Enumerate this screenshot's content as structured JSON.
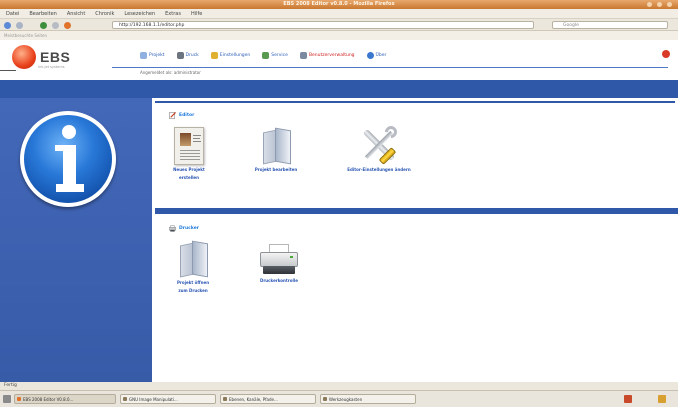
{
  "window": {
    "title": "EBS 2008 Editor v0.8.0 - Mozilla Firefox"
  },
  "menubar": {
    "items": [
      "Datei",
      "Bearbeiten",
      "Ansicht",
      "Chronik",
      "Lesezeichen",
      "Extras",
      "Hilfe"
    ]
  },
  "navbar": {
    "url": "http://192.168.1.1/editor.php",
    "search_placeholder": "Google"
  },
  "bookmarks": {
    "label": "Meistbesuchte Seiten"
  },
  "app": {
    "brand": "EBS",
    "slogan": "ink-jet systems",
    "nav": [
      {
        "label": "Projekt",
        "icon": "folder-icon"
      },
      {
        "label": "Druck",
        "icon": "printer-icon"
      },
      {
        "label": "Einstellungen",
        "icon": "settings-icon"
      },
      {
        "label": "Service",
        "icon": "service-icon"
      },
      {
        "label": "Benutzerverwaltung",
        "icon": "users-icon"
      },
      {
        "label": "Über",
        "icon": "help-icon"
      }
    ],
    "user_line": "Angemeldet als: administrator"
  },
  "sidebar": {
    "icon": "info-icon"
  },
  "editor_panel": {
    "title": "Editor",
    "icon": "pencil-icon",
    "tiles": [
      {
        "label_1": "Neues Projekt",
        "label_2": "erstellen",
        "icon": "document-icon"
      },
      {
        "label_1": "Projekt bearbeiten",
        "label_2": "",
        "icon": "book-icon"
      },
      {
        "label_1": "Editor-Einstellungen ändern",
        "label_2": "",
        "icon": "tools-icon"
      }
    ]
  },
  "druck_panel": {
    "title": "Drucker",
    "icon": "printer-small-icon",
    "tiles": [
      {
        "label_1": "Projekt öffnen",
        "label_2": "zum Drucken",
        "icon": "book-icon"
      },
      {
        "label_1": "Druckerkontrolle",
        "label_2": "",
        "icon": "printer-icon"
      }
    ]
  },
  "statusbar": {
    "text": "Fertig"
  },
  "taskbar": {
    "tasks": [
      "EBS 2008 Editor V0.8.0...",
      "GNU Image Manipulati...",
      "Ebenen, Kanäle, Pfade...",
      "Werkzeugkasten"
    ]
  },
  "colors": {
    "accent_blue": "#2f58a8",
    "sidebar_blue": "#3c5ead",
    "link_blue": "#2a56b3",
    "title_orange": "#c9782f",
    "logo_red": "#e8401a"
  }
}
